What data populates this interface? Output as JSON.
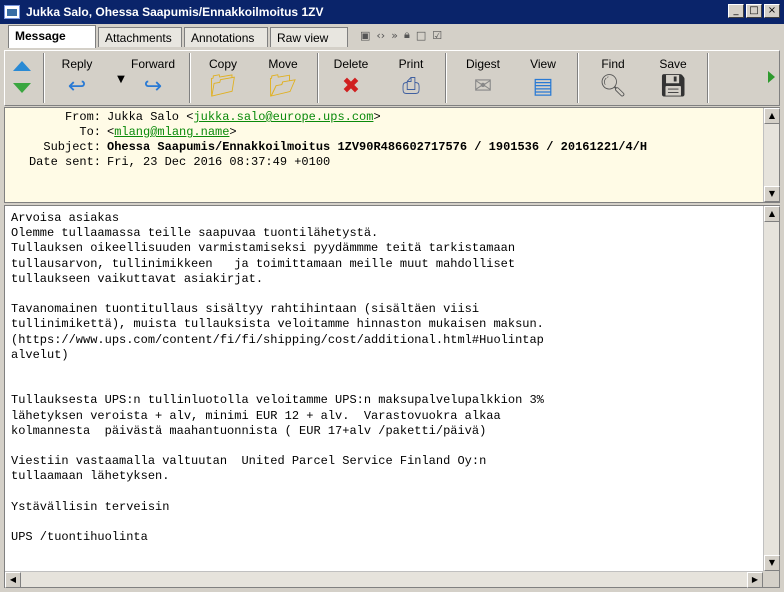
{
  "window": {
    "title": "Jukka Salo, Ohessa Saapumis/Ennakkoilmoitus 1ZV",
    "controls": [
      "_",
      "□",
      "×"
    ]
  },
  "tabs": [
    {
      "label": "Message",
      "active": true
    },
    {
      "label": "Attachments",
      "active": false
    },
    {
      "label": "Annotations",
      "active": false
    },
    {
      "label": "Raw view",
      "active": false
    }
  ],
  "toolbar": {
    "reply": "Reply",
    "forward": "Forward",
    "copy": "Copy",
    "move": "Move",
    "delete": "Delete",
    "print": "Print",
    "digest": "Digest",
    "view": "View",
    "find": "Find",
    "save": "Save"
  },
  "header": {
    "from_label": "From:",
    "from_name": "Jukka Salo <",
    "from_email": "jukka.salo@europe.ups.com",
    "from_end": ">",
    "to_label": "To:",
    "to_start": "<",
    "to_email": "mlang@mlang.name",
    "to_end": ">",
    "subject_label": "Subject:",
    "subject": "Ohessa Saapumis/Ennakkoilmoitus 1ZV90R486602717576 / 1901536 / 20161221/4/H",
    "date_label": "Date sent:",
    "date": "Fri, 23 Dec 2016 08:37:49 +0100"
  },
  "body": {
    "text": "Arvoisa asiakas\nOlemme tullaamassa teille saapuvaa tuontilähetystä.\nTullauksen oikeellisuuden varmistamiseksi pyydämmme teitä tarkistamaan\ntullausarvon, tullinimikkeen   ja toimittamaan meille muut mahdolliset\ntullaukseen vaikuttavat asiakirjat.\n\nTavanomainen tuontitullaus sisältyy rahtihintaan (sisältäen viisi\ntullinimikettä), muista tullauksista veloitamme hinnaston mukaisen maksun.\n(https://www.ups.com/content/fi/fi/shipping/cost/additional.html#Huolintap\nalvelut)\n\n\nTullauksesta UPS:n tullinluotolla veloitamme UPS:n maksupalvelupalkkion 3%\nlähetyksen veroista + alv, minimi EUR 12 + alv.  Varastovuokra alkaa\nkolmannesta  päivästä maahantuonnista ( EUR 17+alv /paketti/päivä)\n\nViestiin vastaamalla valtuutan  United Parcel Service Finland Oy:n\ntullaamaan lähetyksen.\n\nYstävällisin terveisin\n\nUPS /tuontihuolinta"
  },
  "colors": {
    "titlebar": "#0a246a",
    "header_bg": "#fffbe6",
    "link": "#0a8a0a"
  }
}
